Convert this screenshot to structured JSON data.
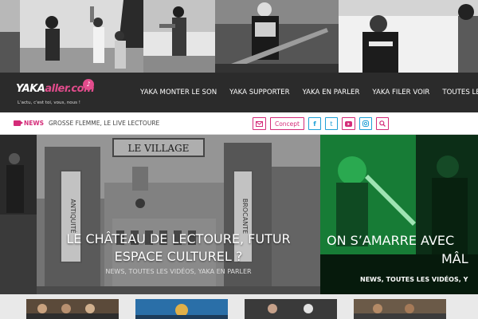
{
  "logo": {
    "word_main": "YAKA",
    "word_accent": "aller.com",
    "tagline": "L'actu, c'est toi, vous, nous !"
  },
  "nav": {
    "items": [
      "YAKA MONTER LE SON",
      "YAKA SUPPORTER",
      "YAKA EN PARLER",
      "YAKA FILER VOIR",
      "TOUTES LES VIDÉOS"
    ]
  },
  "ticker": {
    "label": "NEWS",
    "headline": "GROSSE FLEMME, LE LIVE LECTOURE",
    "concept_label": "Concept",
    "icons": [
      "mail-icon",
      "facebook-icon",
      "twitter-icon",
      "youtube-icon",
      "instagram-icon",
      "search-icon"
    ]
  },
  "slides": {
    "main": {
      "sign_text": "LE VILLAGE",
      "banner_left": "ANTIQUITÉ",
      "banner_right": "BROCANTE",
      "title_line1": "LE CHÂTEAU DE LECTOURE, FUTUR",
      "title_line2": "ESPACE CULTUREL ?",
      "categories": "NEWS, TOUTES LES VIDÉOS, YAKA EN PARLER"
    },
    "right": {
      "title_line1": "ON S’AMARRE AVEC",
      "title_line2": "MÂL",
      "categories": "NEWS, TOUTES LES VIDÉOS, Y"
    }
  },
  "colors": {
    "accent": "#d42c79",
    "nav_bg": "#2b2b2b",
    "social_blue": "#1fa0d6",
    "slide_green": "#1a8a3c"
  }
}
